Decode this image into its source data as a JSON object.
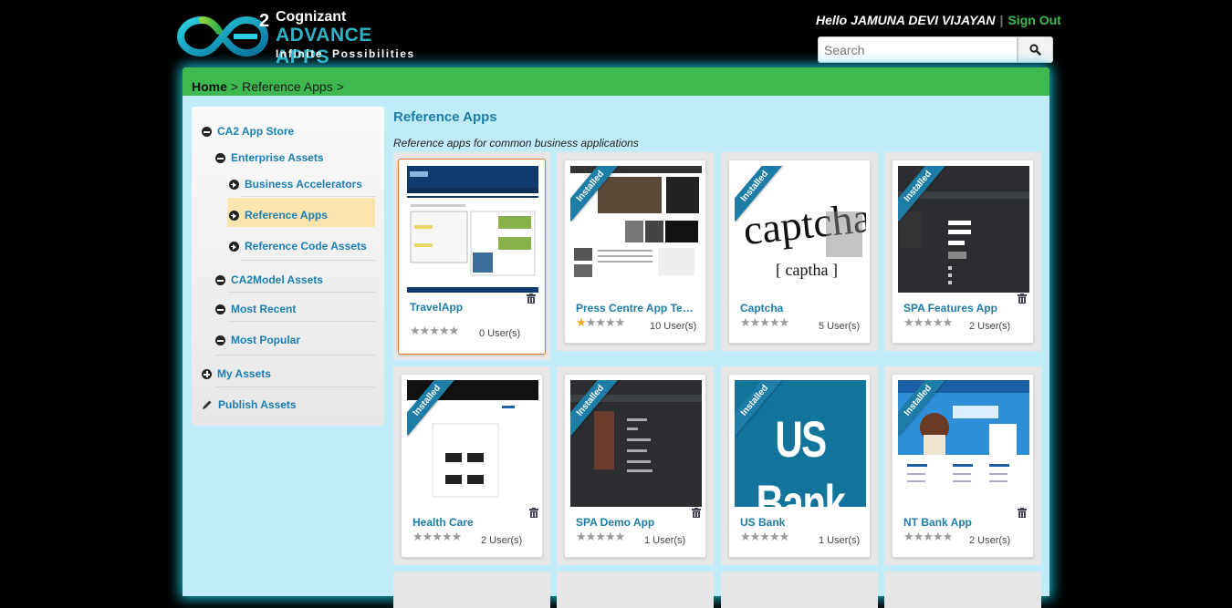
{
  "header": {
    "logo": {
      "company": "Cognizant",
      "product": "ADVANCE APPS",
      "tagline": "Infinite  Possibilities",
      "superscript": "2"
    },
    "greeting": "Hello JAMUNA DEVI VIJAYAN",
    "signout_label": "Sign Out",
    "search_placeholder": "Search"
  },
  "breadcrumb": {
    "home": "Home",
    "current": "Reference Apps",
    "separator": ">"
  },
  "sidebar": {
    "items": [
      {
        "label": "CA2 App Store",
        "icon": "minus-circle-icon"
      },
      {
        "label": "Enterprise Assets",
        "icon": "minus-circle-icon"
      },
      {
        "label": "Business Accelerators",
        "icon": "arrow-circle-icon"
      },
      {
        "label": "Reference Apps",
        "icon": "arrow-circle-icon",
        "active": true
      },
      {
        "label": "Reference Code Assets",
        "icon": "arrow-circle-icon"
      },
      {
        "label": "CA2Model Assets",
        "icon": "minus-circle-icon"
      },
      {
        "label": "Most Recent",
        "icon": "minus-circle-icon"
      },
      {
        "label": "Most Popular",
        "icon": "minus-circle-icon"
      },
      {
        "label": "My Assets",
        "icon": "plus-circle-icon"
      },
      {
        "label": "Publish Assets",
        "icon": "pencil-icon"
      }
    ]
  },
  "content": {
    "title": "Reference Apps",
    "subtitle": "Reference apps for common business applications",
    "ribbon_label": "Installed",
    "apps": [
      {
        "name": "TravelApp",
        "stars": 0,
        "users": "0 User(s)",
        "installed": false,
        "trash": true,
        "selected": true
      },
      {
        "name": "Press Centre App Template",
        "stars": 1,
        "users": "10 User(s)",
        "installed": true,
        "trash": false
      },
      {
        "name": "Captcha",
        "stars": 0,
        "users": "5 User(s)",
        "installed": true,
        "trash": false
      },
      {
        "name": "SPA Features App",
        "stars": 0,
        "users": "2 User(s)",
        "installed": true,
        "trash": true
      },
      {
        "name": "Health Care",
        "stars": 0,
        "users": "2 User(s)",
        "installed": true,
        "trash": true
      },
      {
        "name": "SPA Demo App",
        "stars": 0,
        "users": "1 User(s)",
        "installed": true,
        "trash": true
      },
      {
        "name": "US Bank",
        "stars": 0,
        "users": "1 User(s)",
        "installed": true,
        "trash": false,
        "thumb_text": "US Bank"
      },
      {
        "name": "NT Bank App",
        "stars": 0,
        "users": "2 User(s)",
        "installed": true,
        "trash": true
      }
    ]
  },
  "colors": {
    "accent_green": "#3fb84f",
    "content_bg": "#c0ebf9",
    "link_blue": "#1c7ea8",
    "ribbon_blue": "#1d7da6",
    "star_gold": "#f3a81b"
  }
}
